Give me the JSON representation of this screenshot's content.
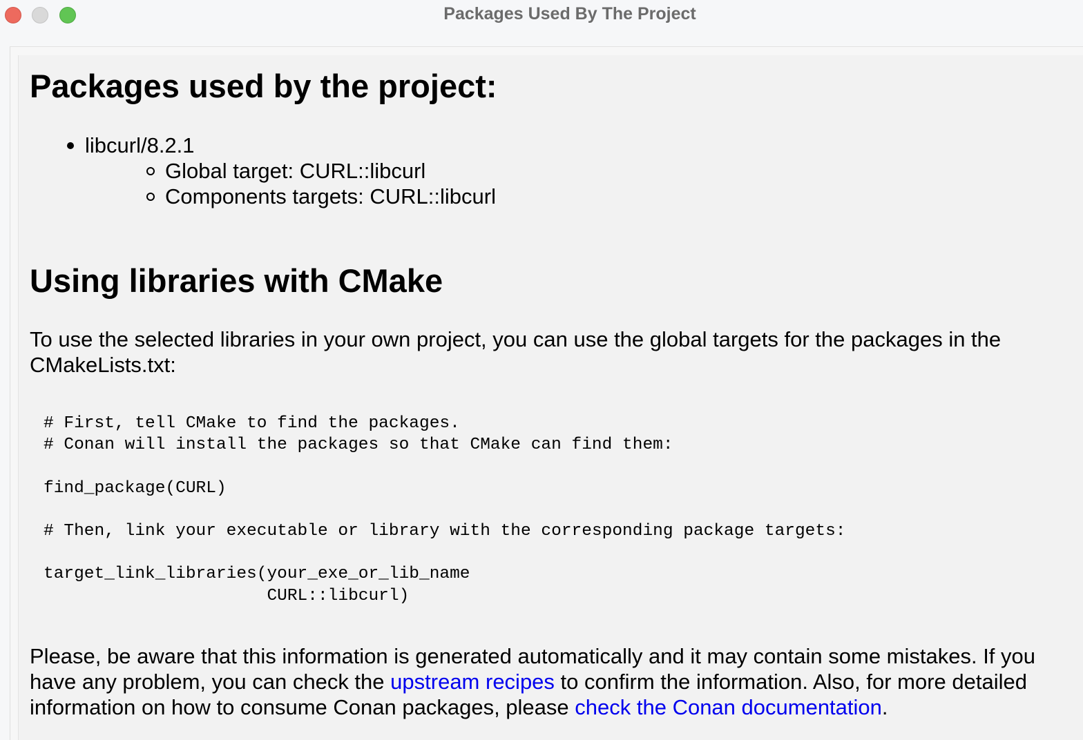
{
  "window": {
    "title": "Packages Used By The Project"
  },
  "headings": {
    "packages": "Packages used by the project:",
    "cmake": "Using libraries with CMake"
  },
  "packages": [
    {
      "name": "libcurl/8.2.1",
      "details": [
        "Global target: CURL::libcurl",
        "Components targets: CURL::libcurl"
      ]
    }
  ],
  "intro": {
    "line1": "To use the selected libraries in your own project, you can use the global targets for the packages in the",
    "line2": "CMakeLists.txt:"
  },
  "code": {
    "lines": [
      "# First, tell CMake to find the packages.",
      "# Conan will install the packages so that CMake can find them:",
      "",
      "find_package(CURL)",
      "",
      "# Then, link your executable or library with the corresponding package targets:",
      "",
      "target_link_libraries(your_exe_or_lib_name",
      "                      CURL::libcurl)"
    ]
  },
  "note": {
    "text1": "Please, be aware that this information is generated automatically and it may contain some mistakes. If you have any problem, you can check the ",
    "link1": "upstream recipes",
    "text2": " to confirm the information. Also, for more detailed information on how to consume Conan packages, please ",
    "link2": "check the Conan documentation",
    "text3": "."
  },
  "colors": {
    "link": "#0000ee",
    "close_button": "#ed6a5e",
    "minimize_button": "#d9d9d9",
    "zoom_button": "#61c554"
  }
}
